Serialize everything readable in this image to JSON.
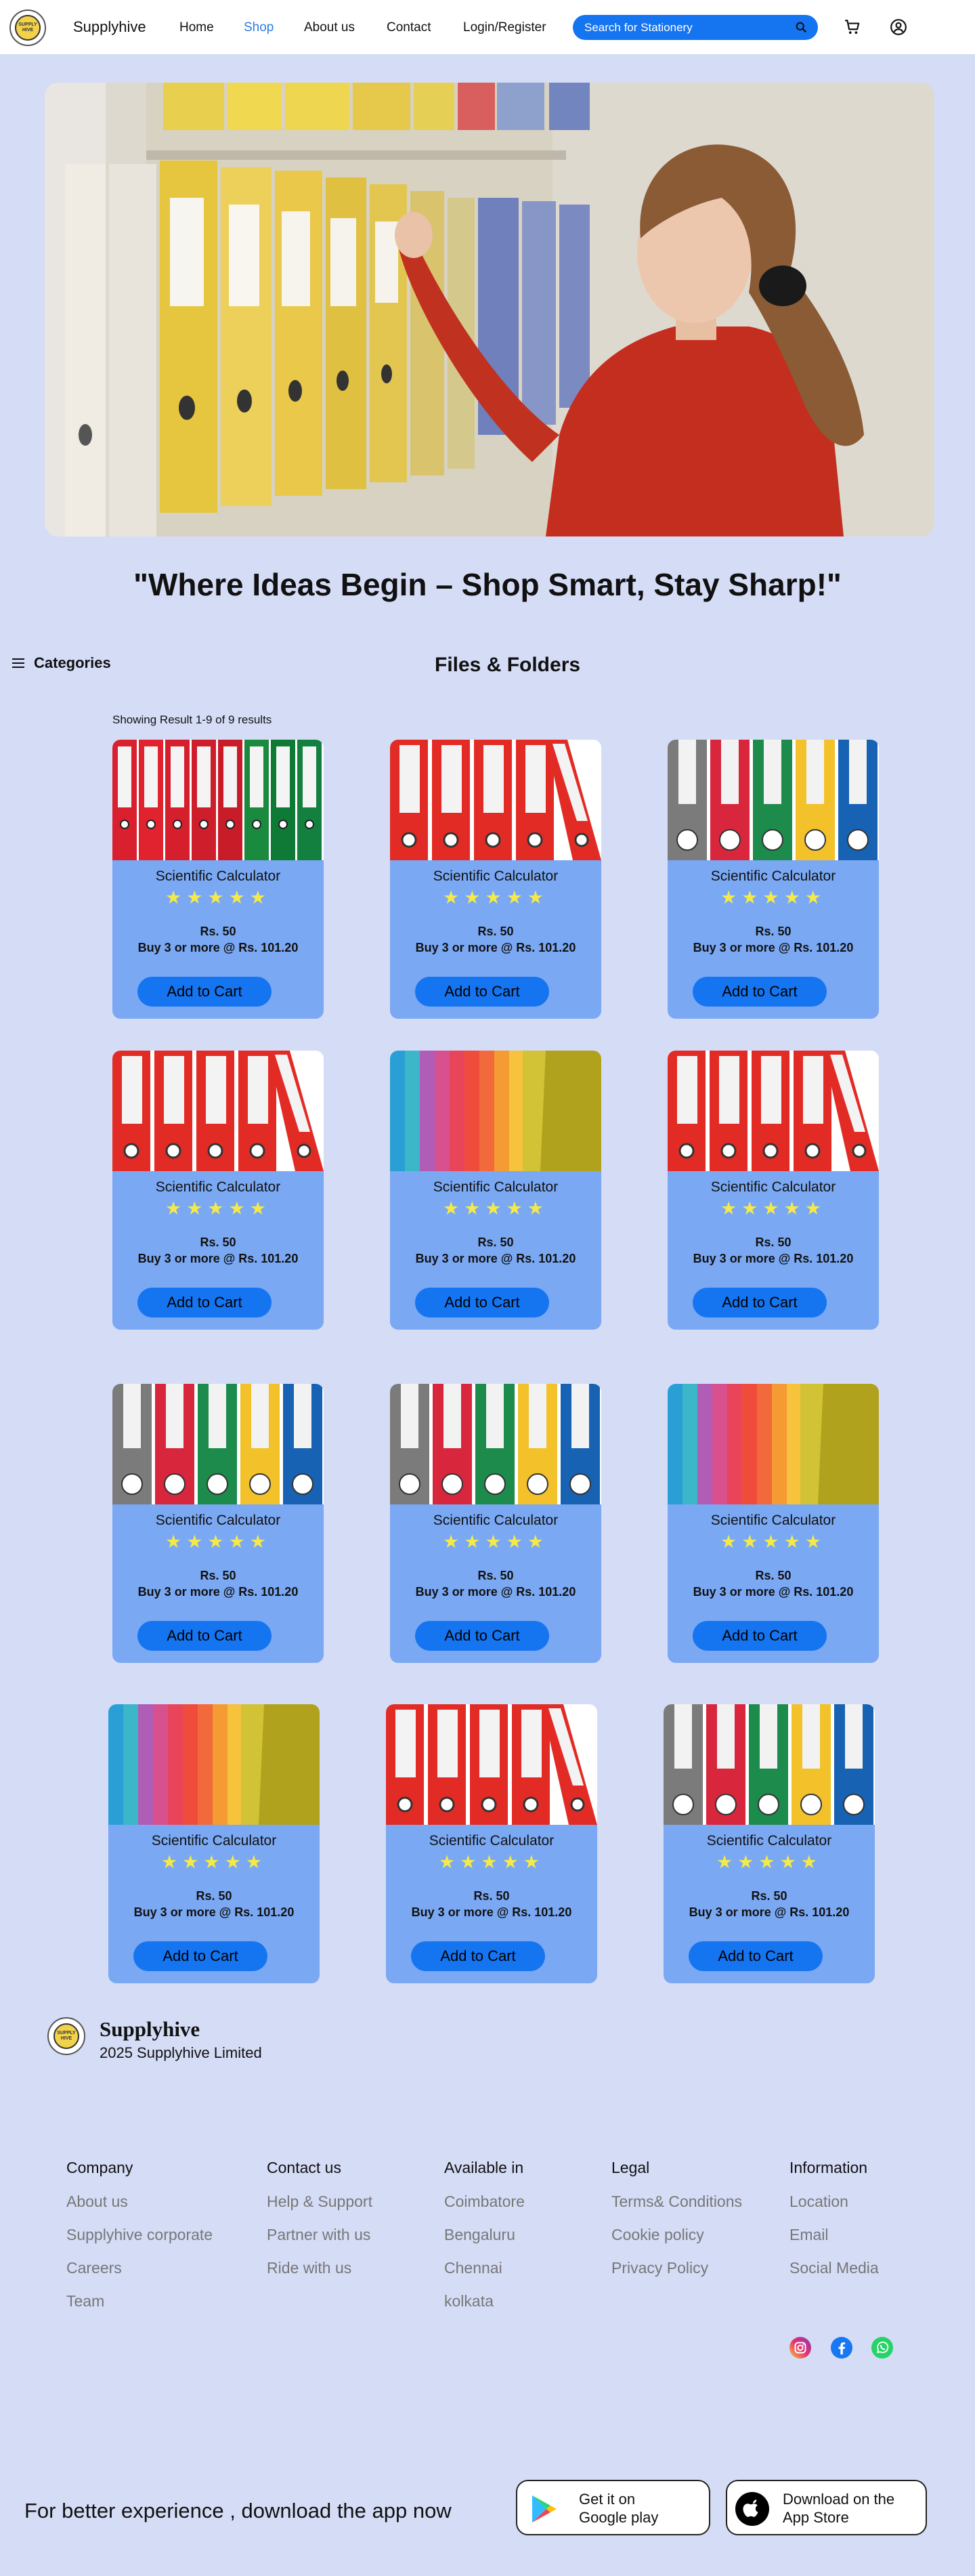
{
  "header": {
    "brand": "Supplyhive",
    "logo_text": "SUPPLY HIVE",
    "nav": [
      {
        "label": "Home"
      },
      {
        "label": "Shop",
        "active": true
      },
      {
        "label": "About us"
      },
      {
        "label": "Contact"
      },
      {
        "label": "Login/Register"
      }
    ],
    "search_placeholder": "Search for Stationery",
    "icons": [
      "search-icon",
      "cart-icon",
      "user-icon"
    ]
  },
  "hero": {
    "tagline": "\"Where Ideas Begin – Shop Smart, Stay Sharp!\""
  },
  "categories_label": "Categories",
  "section_title": "Files & Folders",
  "results_text": "Showing Result 1-9 of 9 results",
  "products": [
    {
      "name": "Scientific Calculator",
      "stars": "★★★★★",
      "price": "Rs. 50",
      "bulk": "Buy 3 or more @ Rs. 101.20",
      "button": "Add to Cart",
      "image": "red-green-binders"
    },
    {
      "name": "Scientific Calculator",
      "stars": "★★★★★",
      "price": "Rs. 50",
      "bulk": "Buy 3 or more @ Rs. 101.20",
      "button": "Add to Cart",
      "image": "red-binders"
    },
    {
      "name": "Scientific Calculator",
      "stars": "★★★★★",
      "price": "Rs. 50",
      "bulk": "Buy 3 or more @ Rs. 101.20",
      "button": "Add to Cart",
      "image": "multicolor-binders"
    },
    {
      "name": "Scientific Calculator",
      "stars": "★★★★★",
      "price": "Rs. 50",
      "bulk": "Buy 3 or more @ Rs. 101.20",
      "button": "Add to Cart",
      "image": "red-binders"
    },
    {
      "name": "Scientific Calculator",
      "stars": "★★★★★",
      "price": "Rs. 50",
      "bulk": "Buy 3 or more @ Rs. 101.20",
      "button": "Add to Cart",
      "image": "rainbow-folders"
    },
    {
      "name": "Scientific Calculator",
      "stars": "★★★★★",
      "price": "Rs. 50",
      "bulk": "Buy 3 or more @ Rs. 101.20",
      "button": "Add to Cart",
      "image": "red-binders"
    },
    {
      "name": "Scientific Calculator",
      "stars": "★★★★★",
      "price": "Rs. 50",
      "bulk": "Buy 3 or more @ Rs. 101.20",
      "button": "Add to Cart",
      "image": "multicolor-binders"
    },
    {
      "name": "Scientific Calculator",
      "stars": "★★★★★",
      "price": "Rs. 50",
      "bulk": "Buy 3 or more @ Rs. 101.20",
      "button": "Add to Cart",
      "image": "multicolor-binders"
    },
    {
      "name": "Scientific Calculator",
      "stars": "★★★★★",
      "price": "Rs. 50",
      "bulk": "Buy 3 or more @ Rs. 101.20",
      "button": "Add to Cart",
      "image": "rainbow-folders"
    },
    {
      "name": "Scientific Calculator",
      "stars": "★★★★★",
      "price": "Rs. 50",
      "bulk": "Buy 3 or more @ Rs. 101.20",
      "button": "Add to Cart",
      "image": "rainbow-folders"
    },
    {
      "name": "Scientific Calculator",
      "stars": "★★★★★",
      "price": "Rs. 50",
      "bulk": "Buy 3 or more @ Rs. 101.20",
      "button": "Add to Cart",
      "image": "red-binders"
    },
    {
      "name": "Scientific Calculator",
      "stars": "★★★★★",
      "price": "Rs. 50",
      "bulk": "Buy 3 or more @ Rs. 101.20",
      "button": "Add to Cart",
      "image": "multicolor-binders"
    }
  ],
  "footer": {
    "brand": "Supplyhive",
    "copyright": "2025 Supplyhive Limited",
    "columns": [
      {
        "heading": "Company",
        "links": [
          "About us",
          "Supplyhive corporate",
          "Careers",
          "Team"
        ]
      },
      {
        "heading": "Contact us",
        "links": [
          "Help & Support",
          "Partner with us",
          "Ride with us"
        ]
      },
      {
        "heading": "Available in",
        "links": [
          "Coimbatore",
          "Bengaluru",
          "Chennai",
          "kolkata"
        ]
      },
      {
        "heading": "Legal",
        "links": [
          "Terms& Conditions",
          "Cookie policy",
          "Privacy Policy"
        ]
      },
      {
        "heading": "Information",
        "links": [
          "Location",
          "Email",
          "Social Media"
        ]
      }
    ],
    "social": [
      "instagram-icon",
      "facebook-icon",
      "whatsapp-icon"
    ]
  },
  "app_banner": {
    "text": "For better experience , download the app now",
    "google": {
      "line1": "Get it on",
      "line2": "Google play"
    },
    "apple": {
      "line1": "Download on the",
      "line2": "App Store"
    }
  },
  "colors": {
    "page_bg": "#d5dcf6",
    "card_bg": "#7aa8f3",
    "accent": "#1574f0",
    "active_nav": "#2d7ce5",
    "star": "#f4e94a"
  }
}
